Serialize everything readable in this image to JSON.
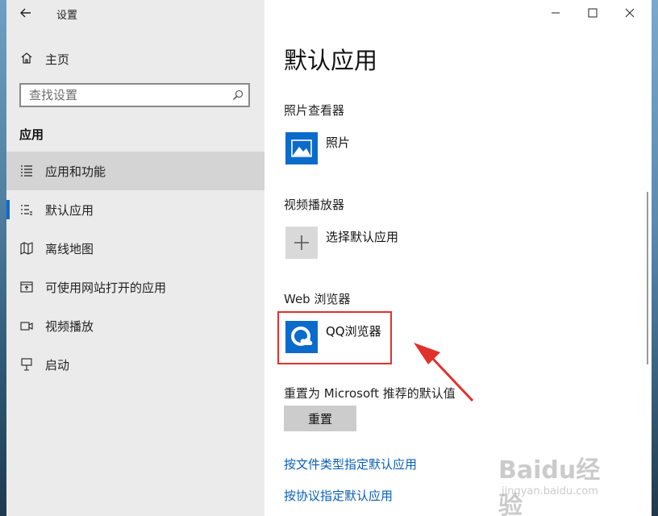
{
  "window": {
    "title": "设置"
  },
  "sidebar": {
    "home_label": "主页",
    "search_placeholder": "查找设置",
    "section_title": "应用",
    "items": [
      {
        "label": "应用和功能",
        "icon": "apps-features-icon",
        "state": "hover"
      },
      {
        "label": "默认应用",
        "icon": "default-apps-icon",
        "state": "selected"
      },
      {
        "label": "离线地图",
        "icon": "offline-maps-icon",
        "state": "normal"
      },
      {
        "label": "可使用网站打开的应用",
        "icon": "apps-for-websites-icon",
        "state": "normal"
      },
      {
        "label": "视频播放",
        "icon": "video-playback-icon",
        "state": "normal"
      },
      {
        "label": "启动",
        "icon": "startup-icon",
        "state": "normal"
      }
    ]
  },
  "main": {
    "page_title": "默认应用",
    "categories": [
      {
        "label": "照片查看器",
        "app_name": "照片",
        "icon": "photos-app-icon"
      },
      {
        "label": "视频播放器",
        "app_name": "选择默认应用",
        "icon": "plus-icon"
      },
      {
        "label": "Web 浏览器",
        "app_name": "QQ浏览器",
        "icon": "qq-browser-icon"
      }
    ],
    "reset": {
      "label": "重置为 Microsoft 推荐的默认值",
      "button": "重置"
    },
    "links": [
      "按文件类型指定默认应用",
      "按协议指定默认应用"
    ]
  },
  "watermark": {
    "logo": "Baidu经验",
    "sub": "jingyan.baidu.com"
  },
  "colors": {
    "accent": "#0b6bcb",
    "link": "#0b5fb4",
    "annotation": "#e0312d",
    "sidebar_bg": "#ebebeb",
    "hover_bg": "#d4d4d4",
    "tile_blue": "#0b6bcb"
  }
}
